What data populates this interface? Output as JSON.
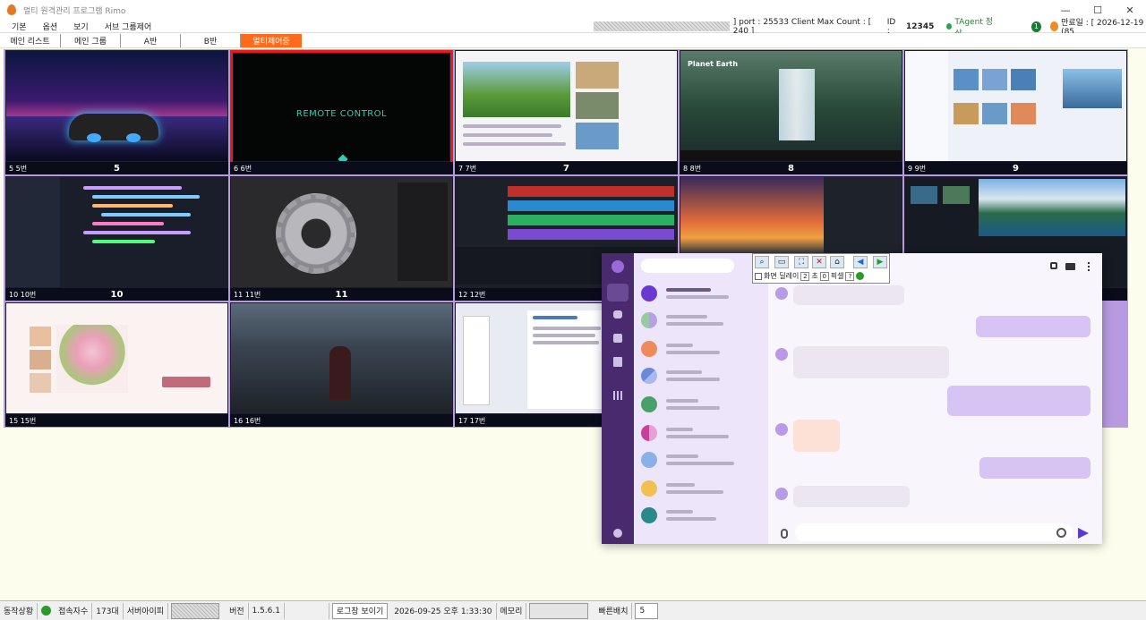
{
  "window": {
    "title": "멀티 원격관리 프로그램 Rimo",
    "min": "—",
    "max": "☐",
    "close": "✕"
  },
  "menu": {
    "items": [
      "기본",
      "옵션",
      "보기",
      "서브 그룹제어"
    ]
  },
  "info": {
    "port_text": "] port : 25533 Client Max Count : [ 240 ]",
    "id_label": "ID :",
    "id_value": "12345",
    "agent_status": "TAgent 정상",
    "notify_count": "1",
    "expiry": "만료일 : [ 2026-12-19 (85"
  },
  "tabs": [
    {
      "label": "메인 리스트"
    },
    {
      "label": "메인 그룹"
    },
    {
      "label": "A반"
    },
    {
      "label": "B반"
    },
    {
      "label": "멀티제어중",
      "active": true
    }
  ],
  "cells": [
    {
      "label": "5 5번",
      "num": "5"
    },
    {
      "label": "6 6번",
      "num": "",
      "text": "REMOTE CONTROL"
    },
    {
      "label": "7 7번",
      "num": "7"
    },
    {
      "label": "8 8번",
      "num": "8",
      "text": "Planet Earth"
    },
    {
      "label": "9 9번",
      "num": "9"
    },
    {
      "label": "10 10번",
      "num": "10"
    },
    {
      "label": "11 11번",
      "num": "11"
    },
    {
      "label": "12 12번",
      "num": ""
    },
    {
      "label": "",
      "num": ""
    },
    {
      "label": "",
      "num": ""
    },
    {
      "label": "15 15번",
      "num": ""
    },
    {
      "label": "16 16번",
      "num": ""
    },
    {
      "label": "17 17번",
      "num": ""
    }
  ],
  "toolbar": {
    "icons": [
      "zoom-icon",
      "monitor-icon",
      "fit-icon",
      "home-icon",
      "close-icon",
      "left-arrow-icon",
      "right-arrow-icon"
    ],
    "screen_delay": "화면 딜레이",
    "delay_value": "2",
    "seconds": "초",
    "pixel_value": "0",
    "pixel": "픽셀",
    "help": "?"
  },
  "status": {
    "state_label": "동작상황",
    "conn_label": "접속자수",
    "conn_value": "173대",
    "server_ip_label": "서버아이피",
    "version_label": "버전",
    "version_value": "1.5.6.1",
    "log_button": "로그창 보이기",
    "datetime": "2026-09-25 오후 1:33:30",
    "memory_label": "메모리",
    "quick_label": "빠른배치",
    "quick_value": "5"
  }
}
